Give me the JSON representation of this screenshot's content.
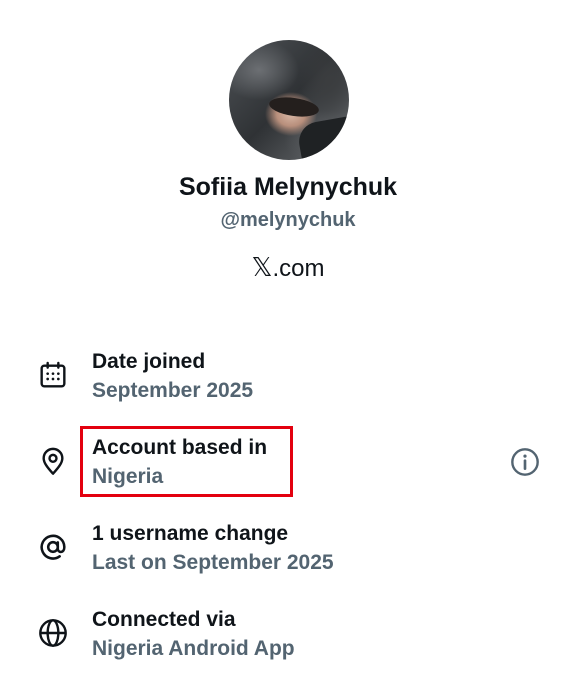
{
  "profile": {
    "display_name": "Sofiia Melynychuk",
    "handle": "@melynychuk",
    "site_suffix": ".com",
    "site_logo": "x-logo",
    "site_logo_glyph": "𝕏"
  },
  "about": {
    "rows": [
      {
        "icon": "calendar-icon",
        "title": "Date joined",
        "value": "September 2025"
      },
      {
        "icon": "location-pin-icon",
        "title": "Account based in",
        "value": "Nigeria",
        "highlighted": true,
        "has_info": true
      },
      {
        "icon": "at-sign-icon",
        "title": "1 username change",
        "value": "Last on September 2025"
      },
      {
        "icon": "globe-icon",
        "title": "Connected via",
        "value": "Nigeria Android App"
      }
    ]
  },
  "colors": {
    "primary_text": "#0f1419",
    "secondary_text": "#536471",
    "highlight_border": "#e3000f"
  }
}
